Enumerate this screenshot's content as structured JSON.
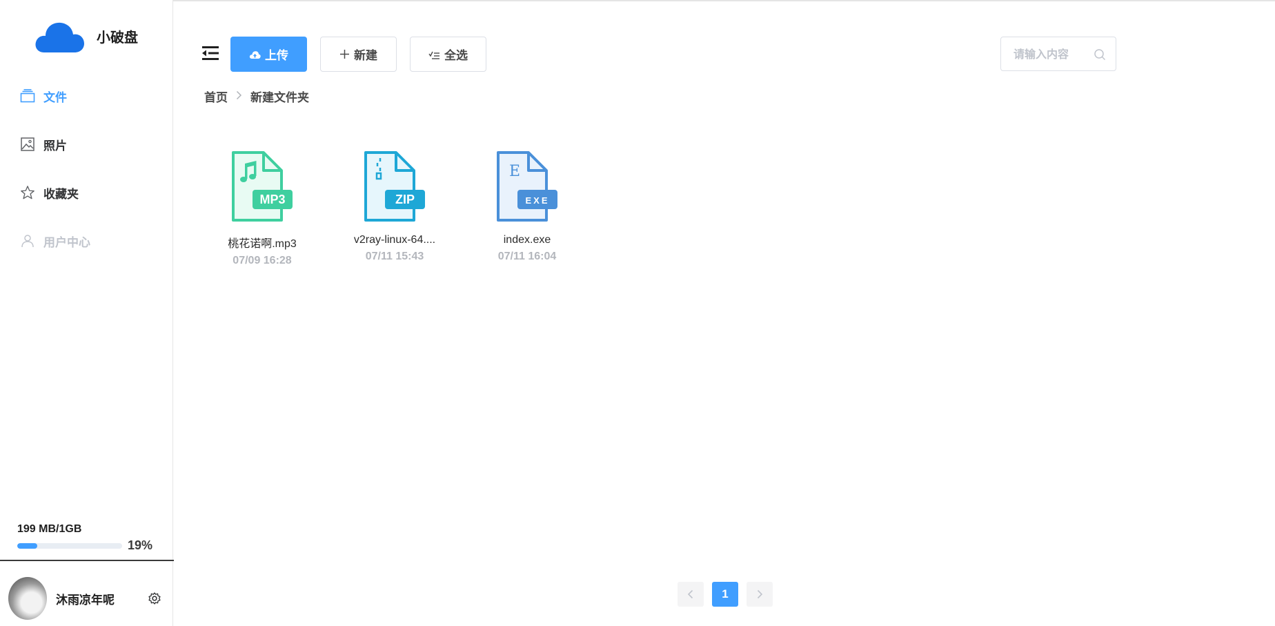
{
  "app": {
    "name": "小破盘",
    "accent": "#409eff"
  },
  "sidebar": {
    "items": [
      {
        "label": "文件",
        "icon": "folder-stack-icon",
        "state": "active"
      },
      {
        "label": "照片",
        "icon": "image-icon",
        "state": "normal"
      },
      {
        "label": "收藏夹",
        "icon": "star-icon",
        "state": "normal"
      },
      {
        "label": "用户中心",
        "icon": "user-icon",
        "state": "disabled"
      }
    ],
    "storage": {
      "text": "199 MB/1GB",
      "percent_label": "19%",
      "percent": 19
    },
    "user": {
      "name": "沐雨凉年呢",
      "settings_icon": "gear-icon"
    }
  },
  "toolbar": {
    "menu_icon": "menu-fold-icon",
    "upload_label": "上传",
    "new_label": "新建",
    "select_all_label": "全选",
    "search_placeholder": "请输入内容"
  },
  "breadcrumb": {
    "items": [
      "首页",
      "新建文件夹"
    ],
    "separator": ">"
  },
  "files": [
    {
      "name": "桃花诺啊.mp3",
      "date": "07/09 16:28",
      "type": "MP3",
      "color": "#3fcf9f"
    },
    {
      "name": "v2ray-linux-64....",
      "date": "07/11 15:43",
      "type": "ZIP",
      "color": "#1ea7d6"
    },
    {
      "name": "index.exe",
      "date": "07/11 16:04",
      "type": "EXE",
      "color": "#4a90d9"
    }
  ],
  "pagination": {
    "current": "1",
    "prev_icon": "chevron-left-icon",
    "next_icon": "chevron-right-icon"
  }
}
